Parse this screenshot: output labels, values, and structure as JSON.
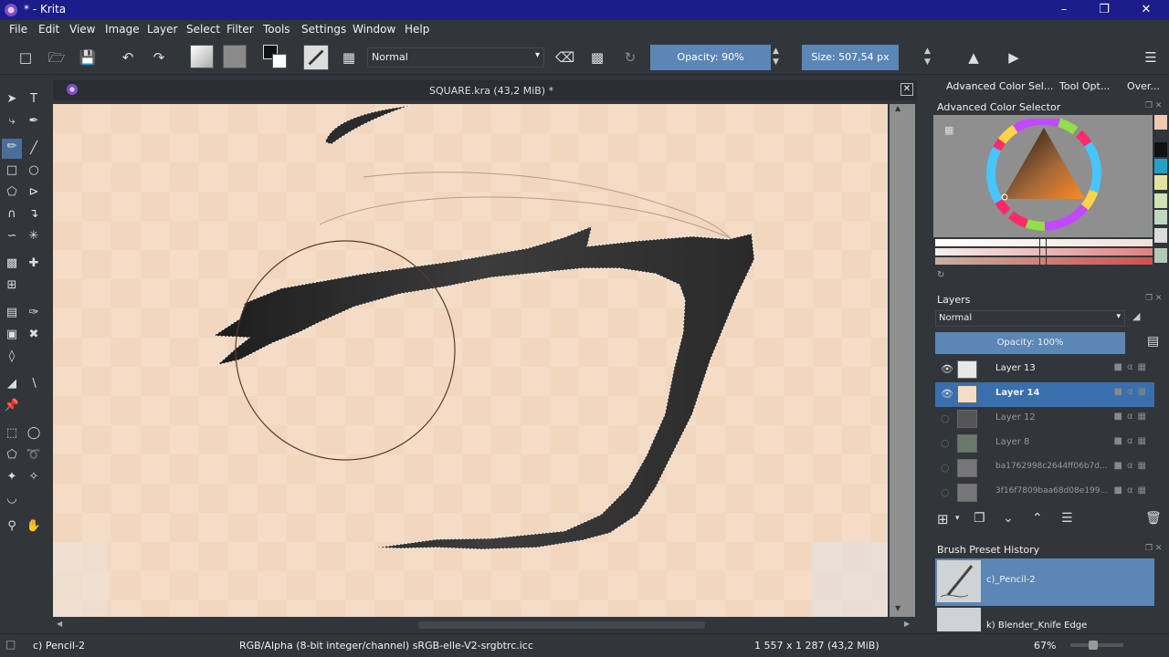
{
  "window": {
    "title": "* - Krita"
  },
  "menubar": {
    "items": [
      "File",
      "Edit",
      "View",
      "Image",
      "Layer",
      "Select",
      "Filter",
      "Tools",
      "Settings",
      "Window",
      "Help"
    ]
  },
  "toolbar": {
    "blend_mode": "Normal",
    "opacity_label": "Opacity: 90%",
    "size_label": "Size: 507,54 px"
  },
  "document": {
    "tab_title": "SQUARE.kra (43,2 MiB) *"
  },
  "dock": {
    "tabs": [
      "Advanced Color Sel...",
      "Tool Opt...",
      "Over..."
    ],
    "color_selector_title": "Advanced Color Selector",
    "layers_title": "Layers",
    "layers_blend_mode": "Normal",
    "layers_opacity": "Opacity:  100%",
    "layers": [
      {
        "name": "Layer 13",
        "visible": true,
        "selected": false
      },
      {
        "name": "Layer 14",
        "visible": true,
        "selected": true
      },
      {
        "name": "Layer 12",
        "visible": false,
        "selected": false
      },
      {
        "name": "Layer 8",
        "visible": false,
        "selected": false
      },
      {
        "name": "ba1762998c2644ff06b7d...",
        "visible": false,
        "selected": false
      },
      {
        "name": "3f16f7809baa68d08e199...",
        "visible": false,
        "selected": false
      }
    ],
    "brush_history_title": "Brush Preset History",
    "brush_presets": [
      "c)_Pencil-2",
      "k) Blender_Knife Edge"
    ]
  },
  "statusbar": {
    "brush": "c) Pencil-2",
    "color_space": "RGB/Alpha (8-bit integer/channel)  sRGB-elle-V2-srgbtrc.icc",
    "dimensions": "1 557 x 1 287 (43,2 MiB)",
    "zoom": "67%"
  },
  "colors": {
    "titlebar": "#1c1c8a",
    "ui_bg": "#31363b",
    "accent": "#5b86b5",
    "selection": "#3a6fae",
    "canvas_bg": "#f5dcc6",
    "stroke": "#2a2a2a"
  }
}
